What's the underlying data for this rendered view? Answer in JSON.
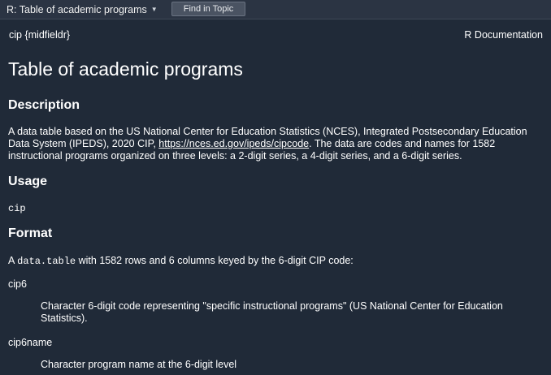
{
  "toolbar": {
    "topic": "R: Table of academic programs",
    "find_label": "Find in Topic"
  },
  "doc": {
    "package_label": "cip {midfieldr}",
    "rdoc_label": "R Documentation",
    "title": "Table of academic programs",
    "description": {
      "heading": "Description",
      "text_before_link": "A data table based on the US National Center for Education Statistics (NCES), Integrated Postsecondary Education Data System (IPEDS), 2020 CIP, ",
      "link_text": "https://nces.ed.gov/ipeds/cipcode",
      "text_after_link": ". The data are codes and names for 1582 instructional programs organized on three levels: a 2-digit series, a 4-digit series, and a 6-digit series."
    },
    "usage": {
      "heading": "Usage",
      "code": "cip"
    },
    "format": {
      "heading": "Format",
      "text_before_code": "A ",
      "code": "data.table",
      "text_after_code": " with 1582 rows and 6 columns keyed by the 6-digit CIP code:",
      "items": [
        {
          "term": "cip6",
          "definition": "Character 6-digit code representing \"specific instructional programs\" (US National Center for Education Statistics)."
        },
        {
          "term": "cip6name",
          "definition": "Character program name at the 6-digit level"
        }
      ]
    }
  }
}
